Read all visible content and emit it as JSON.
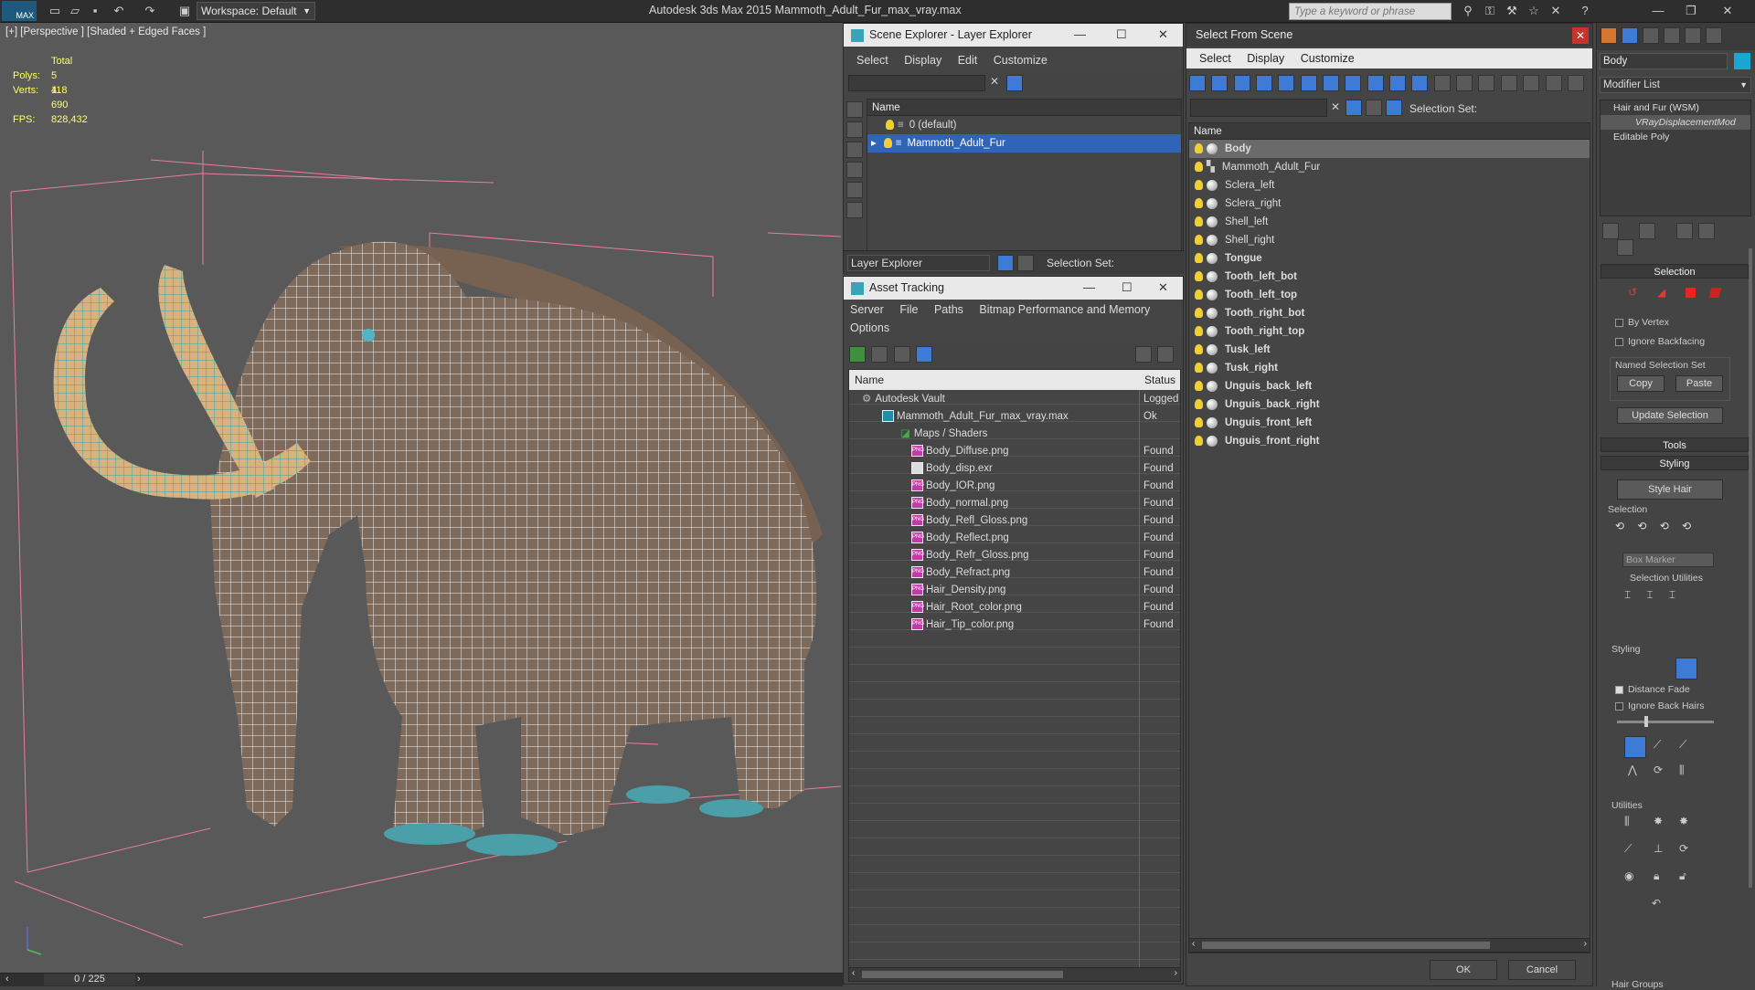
{
  "titlebar": {
    "app_logo": "MAX",
    "workspace_label": "Workspace: Default",
    "title": "Autodesk 3ds Max  2015    Mammoth_Adult_Fur_max_vray.max",
    "search_placeholder": "Type a keyword or phrase"
  },
  "viewport": {
    "label": "[+] [Perspective ] [Shaded + Edged Faces ]",
    "stats": {
      "total_label": "Total",
      "polys_label": "Polys:",
      "polys": "5 118",
      "verts_label": "Verts:",
      "verts": "4 690",
      "fps_label": "FPS:",
      "fps": "828,432"
    }
  },
  "timeline": {
    "frame": "0 / 225"
  },
  "scene_explorer": {
    "title": "Scene Explorer - Layer Explorer",
    "menu": [
      "Select",
      "Display",
      "Edit",
      "Customize"
    ],
    "col_name": "Name",
    "layers": [
      "0 (default)",
      "Mammoth_Adult_Fur"
    ],
    "footer_label": "Layer Explorer",
    "selection_set_label": "Selection Set:"
  },
  "asset_tracking": {
    "title": "Asset Tracking",
    "menu": [
      "Server",
      "File",
      "Paths",
      "Bitmap Performance and Memory"
    ],
    "menu2": "Options",
    "col_name": "Name",
    "col_status": "Status",
    "rows": [
      {
        "name": "Autodesk Vault",
        "status": "Logged"
      },
      {
        "name": "Mammoth_Adult_Fur_max_vray.max",
        "status": "Ok"
      },
      {
        "name": "Maps / Shaders",
        "status": ""
      },
      {
        "name": "Body_Diffuse.png",
        "status": "Found"
      },
      {
        "name": "Body_disp.exr",
        "status": "Found"
      },
      {
        "name": "Body_IOR.png",
        "status": "Found"
      },
      {
        "name": "Body_normal.png",
        "status": "Found"
      },
      {
        "name": "Body_Refl_Gloss.png",
        "status": "Found"
      },
      {
        "name": "Body_Reflect.png",
        "status": "Found"
      },
      {
        "name": "Body_Refr_Gloss.png",
        "status": "Found"
      },
      {
        "name": "Body_Refract.png",
        "status": "Found"
      },
      {
        "name": "Hair_Density.png",
        "status": "Found"
      },
      {
        "name": "Hair_Root_color.png",
        "status": "Found"
      },
      {
        "name": "Hair_Tip_color.png",
        "status": "Found"
      }
    ]
  },
  "select_from_scene": {
    "title": "Select From Scene",
    "menu": [
      "Select",
      "Display",
      "Customize"
    ],
    "selection_set_label": "Selection Set:",
    "col_name": "Name",
    "items": [
      "Body",
      "Mammoth_Adult_Fur",
      "Sclera_left",
      "Sclera_right",
      "Shell_left",
      "Shell_right",
      "Tongue",
      "Tooth_left_bot",
      "Tooth_left_top",
      "Tooth_right_bot",
      "Tooth_right_top",
      "Tusk_left",
      "Tusk_right",
      "Unguis_back_left",
      "Unguis_back_right",
      "Unguis_front_left",
      "Unguis_front_right"
    ],
    "ok_label": "OK",
    "cancel_label": "Cancel"
  },
  "command_panel": {
    "object_name": "Body",
    "modifier_list_label": "Modifier List",
    "stack": [
      "Hair and Fur (WSM)",
      "VRayDisplacementMod",
      "Editable Poly"
    ],
    "selection_rollout": "Selection",
    "by_vertex": "By Vertex",
    "ignore_backfacing": "Ignore Backfacing",
    "named_sel_label": "Named Selection Set",
    "copy_label": "Copy",
    "paste_label": "Paste",
    "update_selection": "Update Selection",
    "tools_rollout": "Tools",
    "styling_rollout": "Styling",
    "style_hair": "Style Hair",
    "selection_group": "Selection",
    "box_marker": "Box Marker",
    "selection_utilities": "Selection Utilities",
    "styling_group": "Styling",
    "distance_fade": "Distance Fade",
    "ignore_back_hairs": "Ignore Back Hairs",
    "utilities_group": "Utilities",
    "hair_groups": "Hair Groups"
  }
}
